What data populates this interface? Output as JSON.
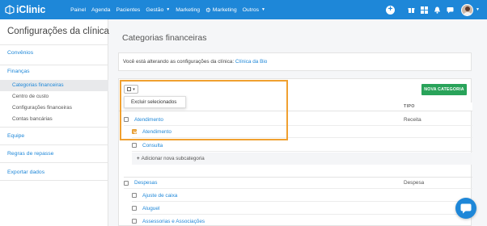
{
  "app": {
    "logo_text": "iClinic"
  },
  "nav": {
    "items": [
      {
        "label": "Painel"
      },
      {
        "label": "Agenda"
      },
      {
        "label": "Pacientes"
      },
      {
        "label": "Gestão"
      },
      {
        "label": "Marketing"
      },
      {
        "label": "Marketing"
      },
      {
        "label": "Outros"
      }
    ]
  },
  "sidebar": {
    "title": "Configurações da clínica",
    "sections": {
      "convenios": "Convênios",
      "financas": "Finanças",
      "equipe": "Equipe",
      "regras": "Regras de repasse",
      "exportar": "Exportar dados"
    },
    "financas_items": [
      {
        "label": "Categorias financeiras"
      },
      {
        "label": "Centro de custo"
      },
      {
        "label": "Configurações financeiras"
      },
      {
        "label": "Contas bancárias"
      }
    ]
  },
  "main": {
    "page_title": "Categorias financeiras",
    "notice_prefix": "Você está alterando as configurações da clínica: ",
    "notice_clinic": "Clínica da Bio",
    "new_category_button": "NOVA CATEGORIA",
    "bulk_menu_item": "Excluir selecionados",
    "column_tipo": "TIPO",
    "add_subcategory": "Adicionar nova subcategoria",
    "rows": {
      "atendimento": {
        "label": "Atendimento",
        "tipo": "Receita"
      },
      "atendimento_sub": {
        "label": "Atendimento"
      },
      "consulta": {
        "label": "Consulta"
      },
      "despesas": {
        "label": "Despesas",
        "tipo": "Despesa"
      },
      "ajuste": {
        "label": "Ajuste de caixa"
      },
      "aluguel": {
        "label": "Aluguel"
      },
      "assessorias": {
        "label": "Assessorias e Associações"
      }
    }
  },
  "colors": {
    "brand": "#1e87d8",
    "success": "#29a35a",
    "highlight": "#f0a030",
    "checkbox_checked": "#f0ad4e"
  }
}
